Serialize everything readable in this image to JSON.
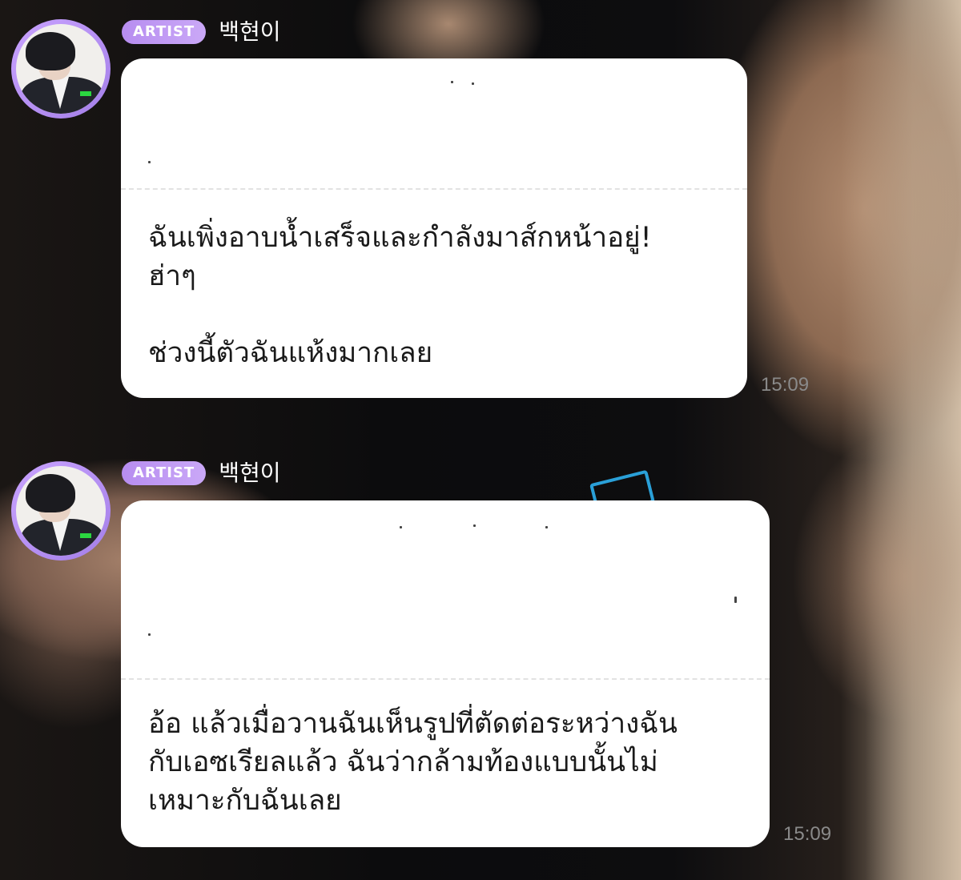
{
  "messages": [
    {
      "tag": "ARTIST",
      "name": "백현이",
      "lines": [
        "ฉันเพิ่งอาบน้ำเสร็จและกำลังมาส์กหน้าอยู่!",
        "ฮ่าๆ",
        "",
        "ช่วงนี้ตัวฉันแห้งมากเลย"
      ],
      "time": "15:09",
      "avatar_icon": "profile-photo"
    },
    {
      "tag": "ARTIST",
      "name": "백현이",
      "lines": [
        "อ้อ แล้วเมื่อวานฉันเห็นรูปที่ตัดต่อระหว่างฉัน",
        "กับเอซเรียลแล้ว ฉันว่ากล้ามท้องแบบนั้นไม่",
        "เหมาะกับฉันเลย"
      ],
      "time": "15:09",
      "avatar_icon": "profile-photo"
    }
  ],
  "colors": {
    "artist_tag": "#b78df0",
    "avatar_ring": "#c9a3ff",
    "bubble": "#ffffff",
    "time": "#8a8a8a"
  }
}
